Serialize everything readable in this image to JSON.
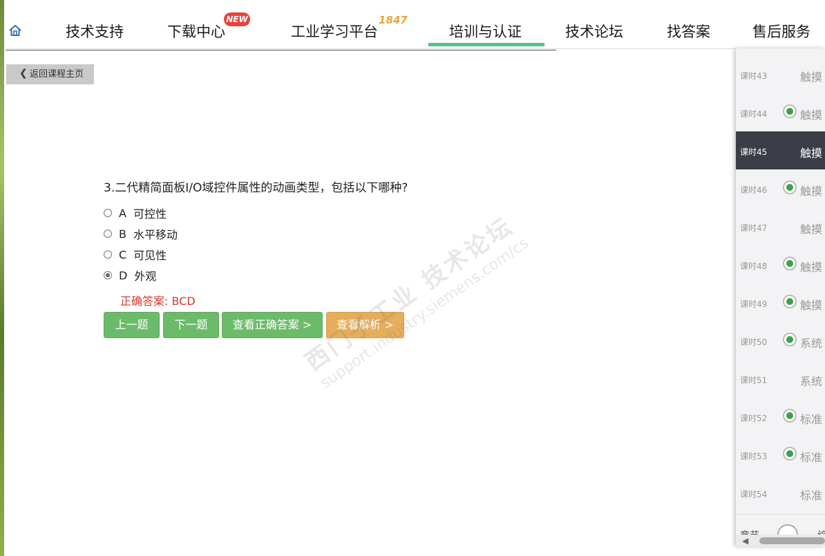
{
  "nav": {
    "items": [
      "技术支持",
      "下载中心",
      "工业学习平台",
      "培训与认证",
      "技术论坛",
      "找答案",
      "售后服务"
    ],
    "badge_new": "NEW",
    "badge_1847": "1847",
    "active_index": 3,
    "accent_color": "#4fc48a"
  },
  "back_button": "返回课程主页",
  "question": {
    "text": "3.二代精简面板I/O域控件属性的动画类型，包括以下哪种?",
    "options": [
      {
        "letter": "A",
        "label": "可控性",
        "selected": false
      },
      {
        "letter": "B",
        "label": "水平移动",
        "selected": false
      },
      {
        "letter": "C",
        "label": "可见性",
        "selected": false
      },
      {
        "letter": "D",
        "label": "外观",
        "selected": true
      }
    ],
    "correct_answer": "正确答案: BCD"
  },
  "buttons": {
    "prev": "上一题",
    "next": "下一题",
    "show_answer": "查看正确答案 >",
    "show_analysis": "查看解析 >"
  },
  "watermark": {
    "line1": "西门子工业 技术论坛",
    "line2": "support.industry.siemens.com/cs"
  },
  "lessons": [
    {
      "num": "课时43",
      "title": "触摸",
      "done": false,
      "active": false
    },
    {
      "num": "课时44",
      "title": "触摸",
      "done": true,
      "active": false
    },
    {
      "num": "课时45",
      "title": "触摸",
      "done": false,
      "active": true
    },
    {
      "num": "课时46",
      "title": "触摸",
      "done": true,
      "active": false
    },
    {
      "num": "课时47",
      "title": "触摸",
      "done": false,
      "active": false
    },
    {
      "num": "课时48",
      "title": "触摸",
      "done": true,
      "active": false
    },
    {
      "num": "课时49",
      "title": "触摸",
      "done": true,
      "active": false
    },
    {
      "num": "课时50",
      "title": "系统",
      "done": true,
      "active": false
    },
    {
      "num": "课时51",
      "title": "系统",
      "done": false,
      "active": false
    },
    {
      "num": "课时52",
      "title": "标准",
      "done": true,
      "active": false
    },
    {
      "num": "课时53",
      "title": "标准",
      "done": true,
      "active": false
    },
    {
      "num": "课时54",
      "title": "标准",
      "done": false,
      "active": false
    }
  ],
  "panel_footer": {
    "left": "章节",
    "right": "综"
  }
}
